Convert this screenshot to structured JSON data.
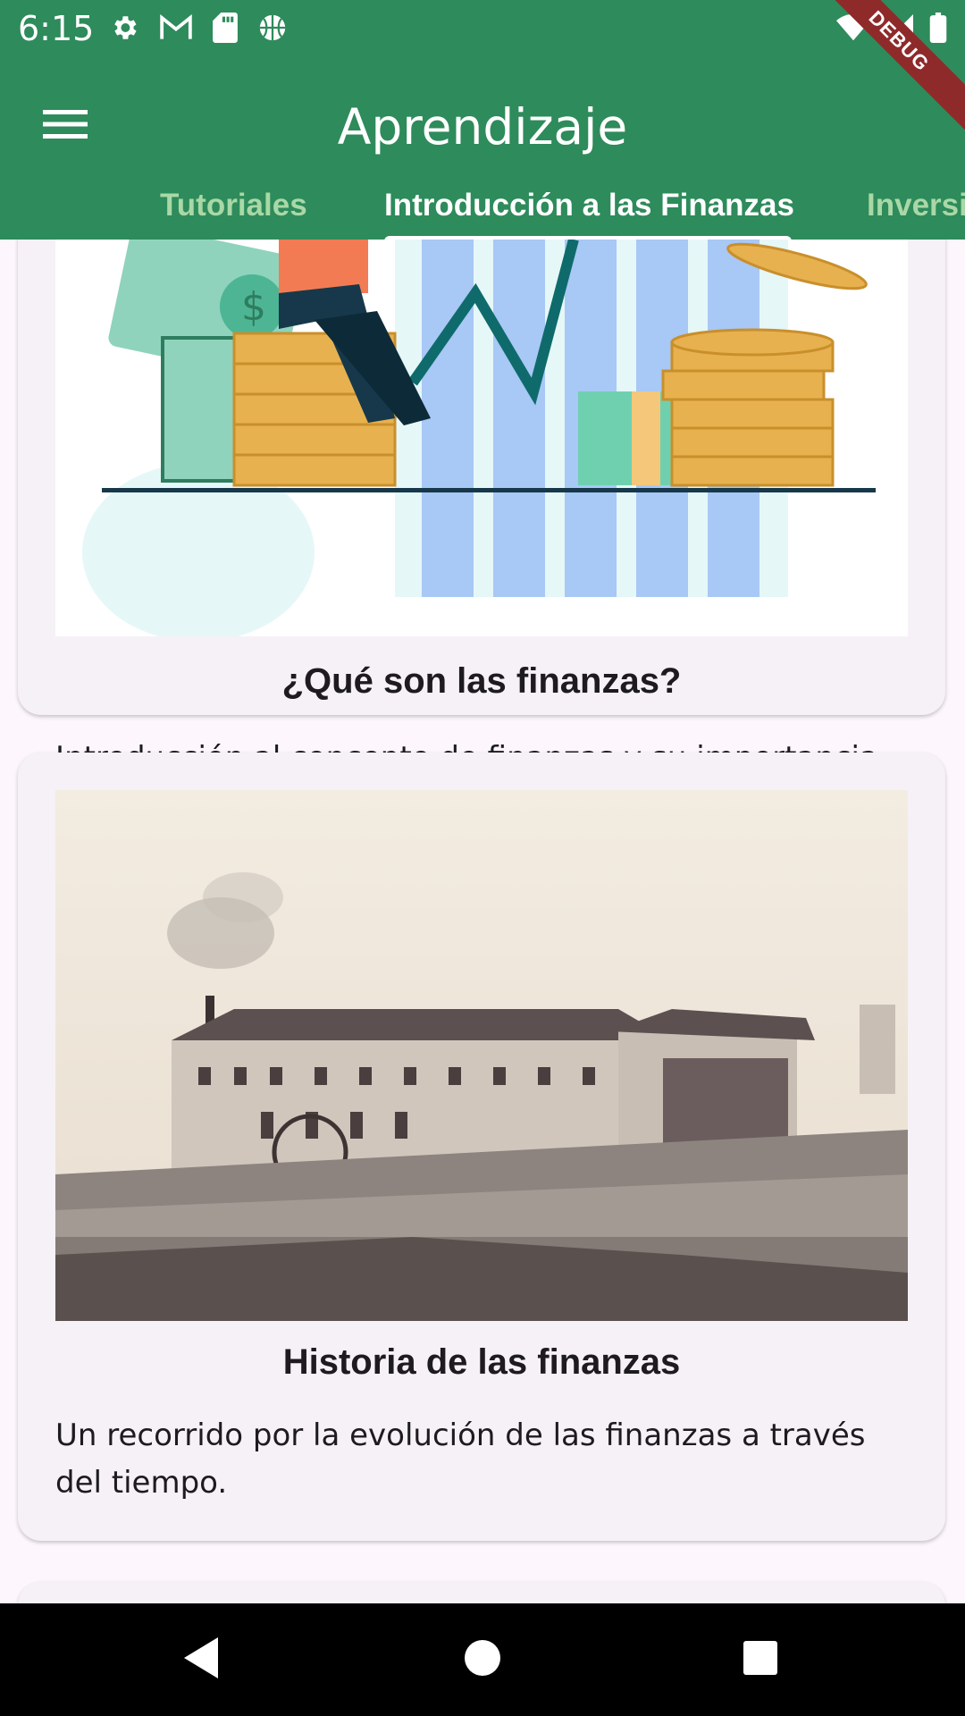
{
  "status_bar": {
    "time": "6:15",
    "left_icons": [
      "gear-icon",
      "gmail-icon",
      "sd-card-icon",
      "basketball-icon"
    ],
    "right_icons": [
      "wifi-icon",
      "signal-icon",
      "battery-icon"
    ]
  },
  "app_bar": {
    "title": "Aprendizaje",
    "menu_icon": "menu-icon"
  },
  "tabs": [
    {
      "label": "Tutoriales",
      "active": false
    },
    {
      "label": "Introducción a las Finanzas",
      "active": true
    },
    {
      "label": "Inversi",
      "active": false
    }
  ],
  "debug_banner": "DEBUG",
  "cards": [
    {
      "title": "¿Qué son las finanzas?",
      "description": "Introducción al concepto de finanzas y su importancia en la vida cotidiana."
    },
    {
      "title": "Historia de las finanzas",
      "description": "Un recorrido por la evolución de las finanzas a través del tiempo."
    }
  ],
  "nav_bar": {
    "icons": [
      "back-icon",
      "home-icon",
      "recents-icon"
    ]
  },
  "colors": {
    "primary": "#2e8b5b",
    "tab_inactive": "#a9d8a6",
    "card_bg": "#f6f1f7",
    "page_bg": "#fdf7fd",
    "debug": "#8e2a2a"
  }
}
